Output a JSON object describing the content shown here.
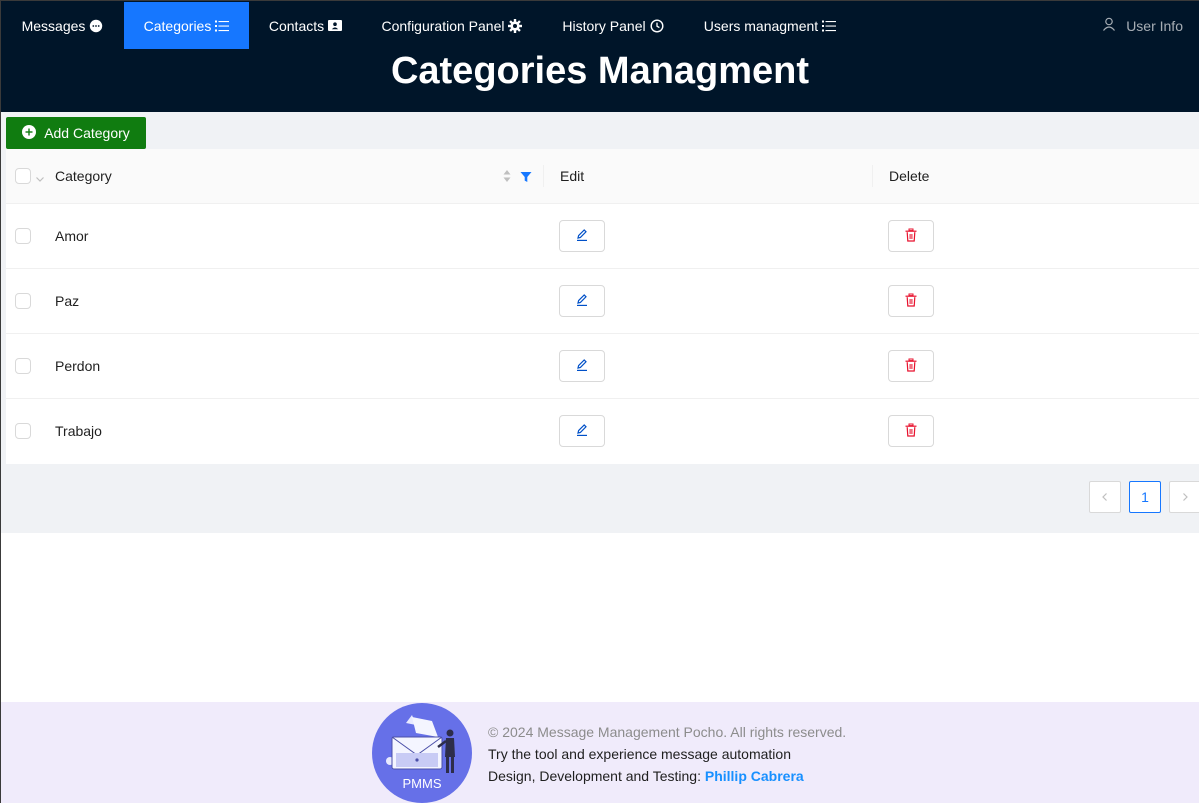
{
  "nav": {
    "items": [
      {
        "label": "Messages",
        "icon": "message-icon",
        "active": false
      },
      {
        "label": "Categories",
        "icon": "list-icon",
        "active": true
      },
      {
        "label": "Contacts",
        "icon": "contacts-icon",
        "active": false
      },
      {
        "label": "Configuration Panel",
        "icon": "gear-icon",
        "active": false
      },
      {
        "label": "History Panel",
        "icon": "history-icon",
        "active": false
      },
      {
        "label": "Users managment",
        "icon": "list-icon",
        "active": false
      }
    ],
    "user_info": "User Info",
    "active_color": "#1677ff",
    "background": "#001529"
  },
  "page": {
    "title": "Categories Managment"
  },
  "toolbar": {
    "add_label": "Add Category",
    "add_color": "#107c10"
  },
  "table": {
    "columns": {
      "category": "Category",
      "edit": "Edit",
      "delete": "Delete"
    },
    "rows": [
      {
        "category": "Amor"
      },
      {
        "category": "Paz"
      },
      {
        "category": "Perdon"
      },
      {
        "category": "Trabajo"
      }
    ]
  },
  "pagination": {
    "current_page": "1"
  },
  "footer": {
    "logo_text": "PMMS",
    "copyright": "© 2024 Message Management Pocho. All rights reserved.",
    "tagline": "Try the tool and experience message automation",
    "credit_prefix": "Design, Development and Testing: ",
    "author": "Phillip Cabrera"
  }
}
